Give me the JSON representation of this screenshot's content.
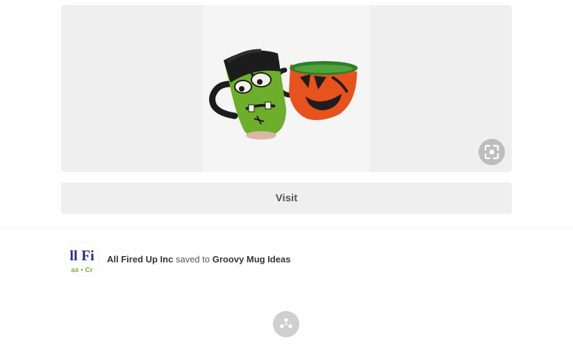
{
  "pin": {
    "image_alt": "Frankenstein mug and jack-o-lantern mug",
    "lens_icon": "visual-search-icon"
  },
  "visit_button": {
    "label": "Visit"
  },
  "attribution": {
    "user_name": "All Fired Up Inc",
    "action_text": "saved to",
    "board_name": "Groovy Mug Ideas",
    "avatar_text_top": "ll Fi",
    "avatar_text_bottom": "ax • Cr"
  },
  "share": {
    "icon": "share-icon"
  },
  "colors": {
    "panel_bg": "#efefef",
    "button_gray": "#bdbdbd",
    "text_dark": "#333333",
    "avatar_navy": "#2b2f7a",
    "avatar_green": "#7bb32e"
  }
}
